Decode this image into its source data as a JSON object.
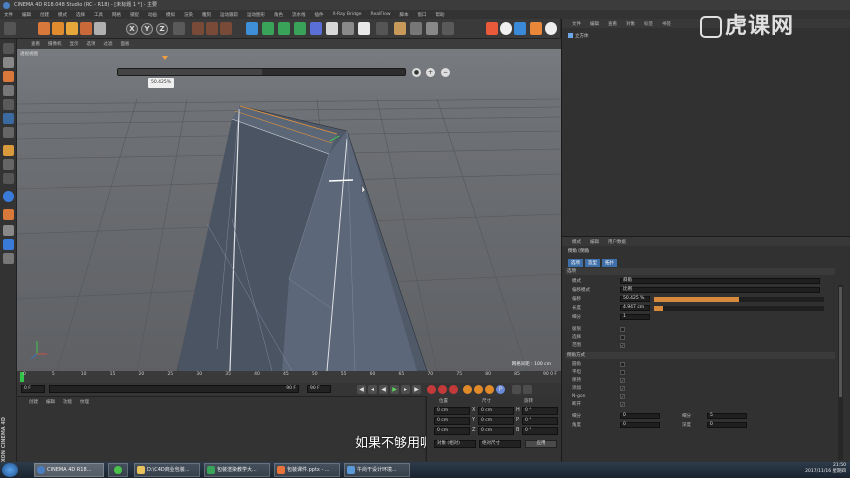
{
  "window": {
    "title": "CINEMA 4D R18.048 Studio (RC - R18) - [未标题 1 *] - 主要"
  },
  "menubar": [
    "文件",
    "编辑",
    "创建",
    "模式",
    "选择",
    "工具",
    "网格",
    "捕捉",
    "动画",
    "模拟",
    "渲染",
    "雕刻",
    "运动跟踪",
    "运动图形",
    "角色",
    "流水线",
    "插件",
    "X-Ray Bridge",
    "RealFlow",
    "脚本",
    "窗口",
    "帮助"
  ],
  "viewport": {
    "menu": [
      "查看",
      "摄像机",
      "显示",
      "选项",
      "过滤",
      "面板"
    ],
    "label": "透视视图",
    "slider_value": "50.425%",
    "slider_fraction": 0.5,
    "grid_info": "网格间距 : 100 cm"
  },
  "timeline": {
    "ticks": [
      "0",
      "5",
      "10",
      "15",
      "20",
      "25",
      "30",
      "35",
      "40",
      "45",
      "50",
      "55",
      "60",
      "65",
      "70",
      "75",
      "80",
      "85",
      "90"
    ],
    "end_label": "0 F",
    "start_field": "0 F",
    "current_field": "0 F",
    "end_field": "90 F",
    "max_field": "90 F"
  },
  "material_manager": {
    "menu": [
      "创建",
      "编辑",
      "功能",
      "纹理"
    ]
  },
  "subtitle": "如果不够用呢",
  "coordinates": {
    "headers": [
      "位置",
      "尺寸",
      "旋转"
    ],
    "rows": [
      {
        "pos": "0 cm",
        "axis": "X",
        "size": "0 cm",
        "rot_label": "H",
        "rot": "0 °"
      },
      {
        "pos": "0 cm",
        "axis": "Y",
        "size": "0 cm",
        "rot_label": "P",
        "rot": "0 °"
      },
      {
        "pos": "0 cm",
        "axis": "Z",
        "size": "0 cm",
        "rot_label": "B",
        "rot": "0 °"
      }
    ],
    "mode_obj": "对象 (相对)",
    "mode_size": "绝对尺寸",
    "apply": "应用"
  },
  "object_manager": {
    "menu": [
      "文件",
      "编辑",
      "查看",
      "对象",
      "标签",
      "书签"
    ],
    "object": "立方体"
  },
  "watermark": "虎课网",
  "attributes": {
    "menu": [
      "模式",
      "编辑",
      "用户数据"
    ],
    "title": "倒角 [倒角",
    "tabs": [
      "选项",
      "造型",
      "拓扑"
    ],
    "section_tool": "选项",
    "rows": [
      {
        "label": "模式",
        "value": "斜角"
      },
      {
        "label": "偏移模式",
        "value": "比例"
      },
      {
        "label": "偏移",
        "value": "50.425 %",
        "fraction": 0.5
      },
      {
        "label": "长度",
        "value": "4.947 cm",
        "fraction": 0.05
      },
      {
        "label": "细分",
        "value": "1"
      }
    ],
    "checks1": [
      {
        "label": "极限",
        "checked": false
      },
      {
        "label": "选择",
        "checked": false
      },
      {
        "label": "范围",
        "checked": true
      }
    ],
    "section_shape": "倒角方式",
    "checks2": [
      {
        "label": "圆角",
        "checked": false
      },
      {
        "label": "平坦",
        "checked": false
      },
      {
        "label": "保持",
        "checked": true
      },
      {
        "label": "添加",
        "checked": true
      },
      {
        "label": "N-gon",
        "checked": true
      },
      {
        "label": "断开",
        "checked": true
      }
    ],
    "tail_rows": [
      {
        "label": "细分",
        "value": "0",
        "label2": "细分",
        "value2": "5"
      },
      {
        "label": "角度",
        "value": "0",
        "label2": "深度",
        "value2": "0"
      }
    ]
  },
  "taskbar": {
    "tasks": [
      "CINEMA 4D R18...",
      "",
      "D:\\C4D商业包装...",
      "包装渲染教学大...",
      "包装课件.pptx - ...",
      "午尚干设计环境..."
    ],
    "clock": "21:50",
    "date": "2017/11/16 星期四"
  },
  "colors": {
    "accent": "#3f6fa8",
    "orange": "#d88a3c",
    "viewport": "#6b6e72"
  }
}
